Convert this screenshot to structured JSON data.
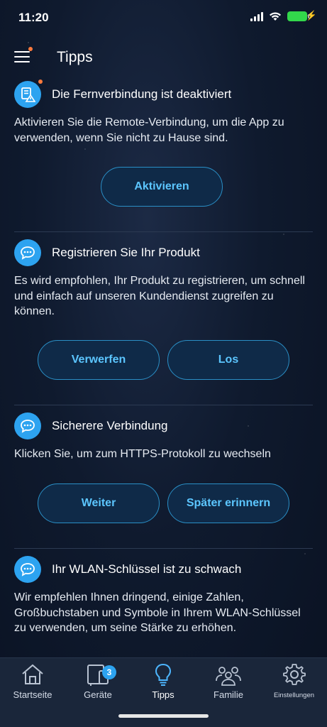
{
  "status_bar": {
    "time": "11:20"
  },
  "header": {
    "title": "Tipps"
  },
  "cards": [
    {
      "title": "Die Fernverbindung ist deaktiviert",
      "text": "Aktivieren Sie die Remote-Verbindung, um die App zu verwenden, wenn Sie nicht zu Hause sind.",
      "buttons": [
        "Aktivieren"
      ]
    },
    {
      "title": "Registrieren Sie Ihr Produkt",
      "text": "Es wird empfohlen, Ihr Produkt zu registrieren, um schnell und einfach auf unseren Kundendienst zugreifen zu können.",
      "buttons": [
        "Verwerfen",
        "Los"
      ]
    },
    {
      "title": "Sicherere Verbindung",
      "text": "Klicken Sie, um zum HTTPS-Protokoll zu wechseln",
      "buttons": [
        "Weiter",
        "Später erinnern"
      ]
    },
    {
      "title": "Ihr WLAN-Schlüssel ist zu schwach",
      "text": "Wir empfehlen Ihnen dringend, einige Zahlen, Großbuchstaben und Symbole in Ihrem WLAN-Schlüssel zu verwenden, um seine Stärke zu erhöhen.",
      "buttons": []
    }
  ],
  "tabbar": {
    "items": [
      {
        "label": "Startseite",
        "icon": "home-icon"
      },
      {
        "label": "Geräte",
        "icon": "devices-icon",
        "badge": "3"
      },
      {
        "label": "Tipps",
        "icon": "lightbulb-icon",
        "active": true
      },
      {
        "label": "Familie",
        "icon": "family-icon"
      },
      {
        "label": "Einstellungen",
        "icon": "gear-icon"
      }
    ]
  },
  "colors": {
    "accent": "#2da3f0",
    "button_text": "#5cc6ff",
    "notification_dot": "#ff7a3d",
    "battery": "#32d74b"
  }
}
